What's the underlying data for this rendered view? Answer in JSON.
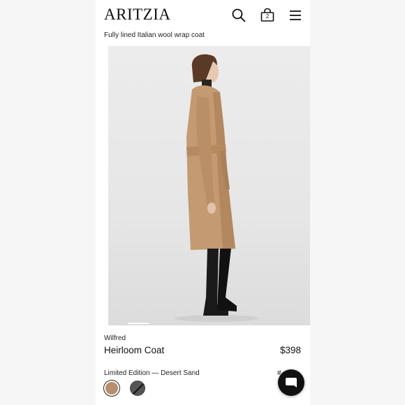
{
  "header": {
    "logo": "ARITZIA",
    "bag_count": "2",
    "tagline": "Fully lined Italian wool wrap coat"
  },
  "product": {
    "brand": "Wilfred",
    "name": "Heirloom Coat",
    "price": "$398",
    "color_label": "Limited Edition — Desert Sand",
    "color_number": "#"
  },
  "swatches": [
    {
      "name": "Desert Sand",
      "color": "#b88f6c",
      "selected": true
    },
    {
      "name": "Black",
      "color": "#555555",
      "available": false
    }
  ],
  "icons": {
    "search": "search-icon",
    "bag": "shopping-bag-icon",
    "menu": "hamburger-menu-icon",
    "chat": "chat-bubble-icon"
  },
  "carousel": {
    "current": 1
  }
}
